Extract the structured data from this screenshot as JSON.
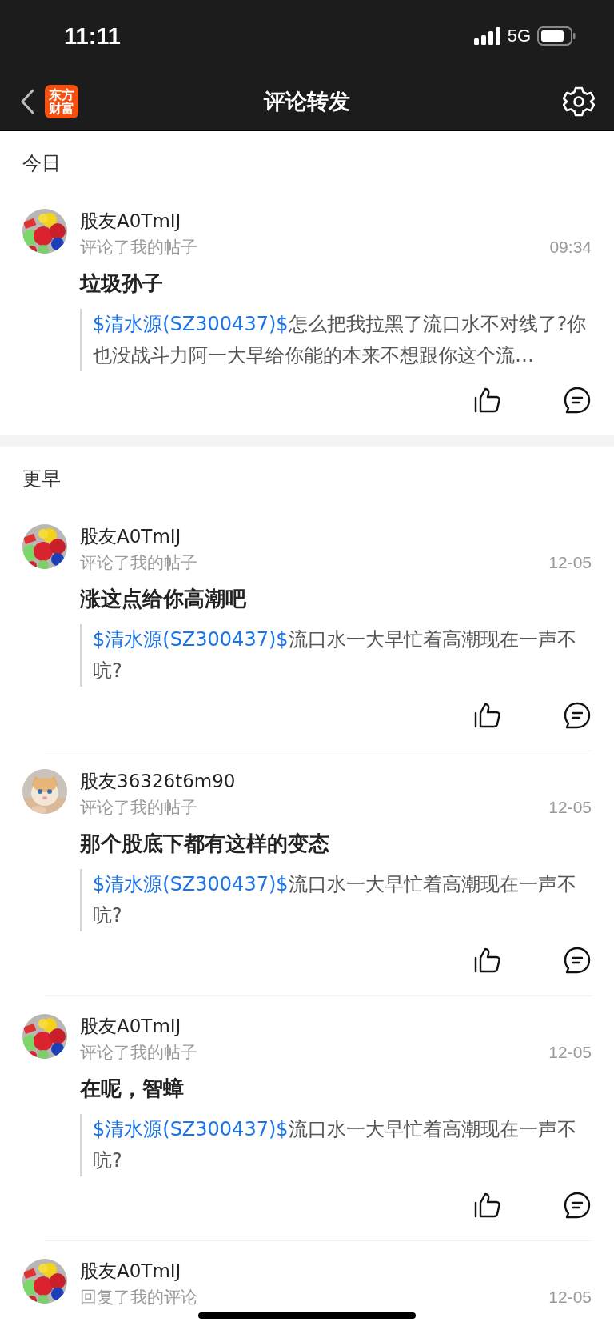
{
  "status_bar": {
    "time": "11:11",
    "network": "5G"
  },
  "nav": {
    "logo": "东方财富",
    "title": "评论转发"
  },
  "sections": [
    {
      "title": "今日",
      "items": [
        {
          "user": "股友A0TmIJ",
          "action": "评论了我的帖子",
          "time": "09:34",
          "comment": "垃圾孙子",
          "quote": {
            "stock": "$清水源(SZ300437)$",
            "text": "怎么把我拉黑了流口水不对线了?你也没战斗力阿一大早给你能的本来不想跟你这个流…"
          }
        }
      ]
    },
    {
      "title": "更早",
      "items": [
        {
          "user": "股友A0TmIJ",
          "action": "评论了我的帖子",
          "time": "12-05",
          "comment": "涨这点给你高潮吧",
          "quote": {
            "stock": "$清水源(SZ300437)$",
            "text": "流口水一大早忙着高潮现在一声不吭?"
          }
        },
        {
          "user": "股友36326t6m90",
          "action": "评论了我的帖子",
          "time": "12-05",
          "comment": "那个股底下都有这样的变态",
          "quote": {
            "stock": "$清水源(SZ300437)$",
            "text": "流口水一大早忙着高潮现在一声不吭?"
          }
        },
        {
          "user": "股友A0TmIJ",
          "action": "评论了我的帖子",
          "time": "12-05",
          "comment": "在呢，智蟑",
          "quote": {
            "stock": "$清水源(SZ300437)$",
            "text": "流口水一大早忙着高潮现在一声不吭?"
          }
        },
        {
          "user": "股友A0TmIJ",
          "action": "回复了我的评论",
          "time": "12-05"
        }
      ]
    }
  ]
}
